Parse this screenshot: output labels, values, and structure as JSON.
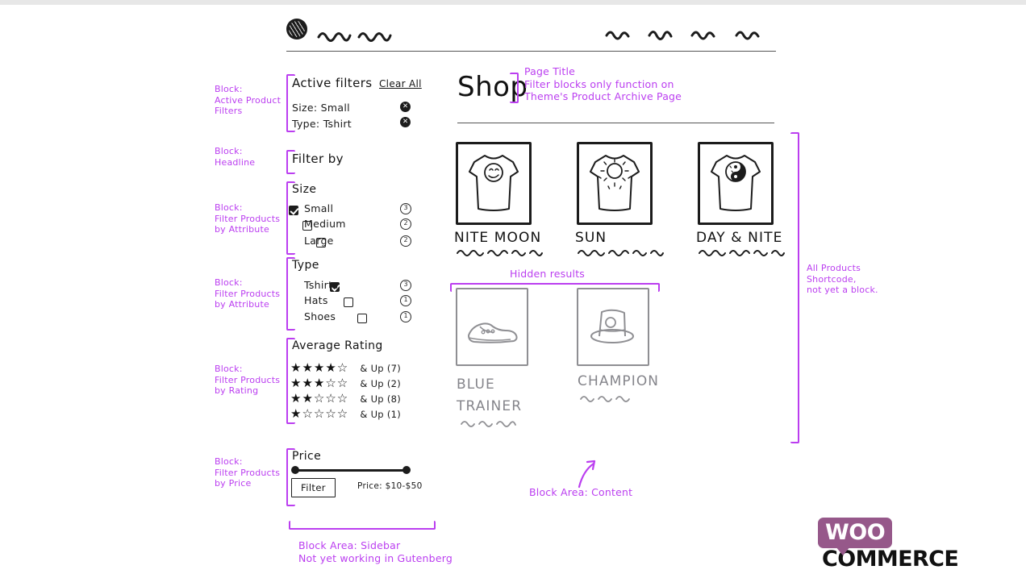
{
  "meta": {
    "accent_purple": "#bb3ef0",
    "ink": "#1a1a1a",
    "muted_gray": "#8f8f93",
    "woo_purple": "#96588a"
  },
  "header": {
    "logo_icon": "scribble-circle-logo",
    "brand_squiggles": 2,
    "nav_squiggles": 4
  },
  "annotations": {
    "active_filters_block": "Block:\nActive Product\nFilters",
    "headline_block": "Block:\nHeadline",
    "attribute_block_size": "Block:\nFilter Products\nby Attribute",
    "attribute_block_type": "Block:\nFilter Products\nby Attribute",
    "rating_block": "Block:\nFilter Products\nby Rating",
    "price_block": "Block:\nFilter Products\nby Price",
    "sidebar_area": "Block Area: Sidebar\nNot yet working in Gutenberg",
    "page_title_note": "Page Title\nFilter blocks only function on\nTheme's Product Archive Page",
    "hidden_results": "Hidden results",
    "content_area": "Block Area: Content",
    "all_products_note": "All Products\nShortcode,\nnot yet a block."
  },
  "sidebar": {
    "active_filters": {
      "title": "Active filters",
      "clear_all": "Clear All",
      "items": [
        {
          "label": "Size: Small",
          "remove_icon": "x-circle-icon"
        },
        {
          "label": "Type: Tshirt",
          "remove_icon": "x-circle-icon"
        }
      ]
    },
    "headline": "Filter by",
    "size_filter": {
      "title": "Size",
      "options": [
        {
          "label": "Small",
          "checked": true,
          "count": "3"
        },
        {
          "label": "Medium",
          "checked": false,
          "count": "2"
        },
        {
          "label": "Large",
          "checked": false,
          "count": "2"
        }
      ]
    },
    "type_filter": {
      "title": "Type",
      "options": [
        {
          "label": "Tshirts",
          "checked": true,
          "count": "3"
        },
        {
          "label": "Hats",
          "checked": false,
          "count": "1"
        },
        {
          "label": "Shoes",
          "checked": false,
          "count": "1"
        }
      ]
    },
    "rating_filter": {
      "title": "Average Rating",
      "rows": [
        {
          "filled": 4,
          "empty": 1,
          "label": "& Up (7)"
        },
        {
          "filled": 3,
          "empty": 2,
          "label": "& Up (2)"
        },
        {
          "filled": 2,
          "empty": 3,
          "label": "& Up (8)"
        },
        {
          "filled": 1,
          "empty": 4,
          "label": "& Up (1)"
        }
      ]
    },
    "price_filter": {
      "title": "Price",
      "button_label": "Filter",
      "range_label": "Price: $10-$50"
    }
  },
  "content": {
    "page_title": "Shop",
    "products": [
      {
        "name": "NITE MOON",
        "art": "tshirt-moon-face",
        "hidden": false
      },
      {
        "name": "SUN",
        "art": "tshirt-sun",
        "hidden": false
      },
      {
        "name": "DAY & NITE",
        "art": "tshirt-yin-yang",
        "hidden": false
      }
    ],
    "hidden_products": [
      {
        "name": "BLUE TRAINER",
        "art": "sneaker",
        "hidden": true
      },
      {
        "name": "CHAMPION",
        "art": "hat",
        "hidden": true
      }
    ]
  },
  "footer": {
    "logo_word_1": "WOO",
    "logo_word_2": "COMMERCE"
  }
}
